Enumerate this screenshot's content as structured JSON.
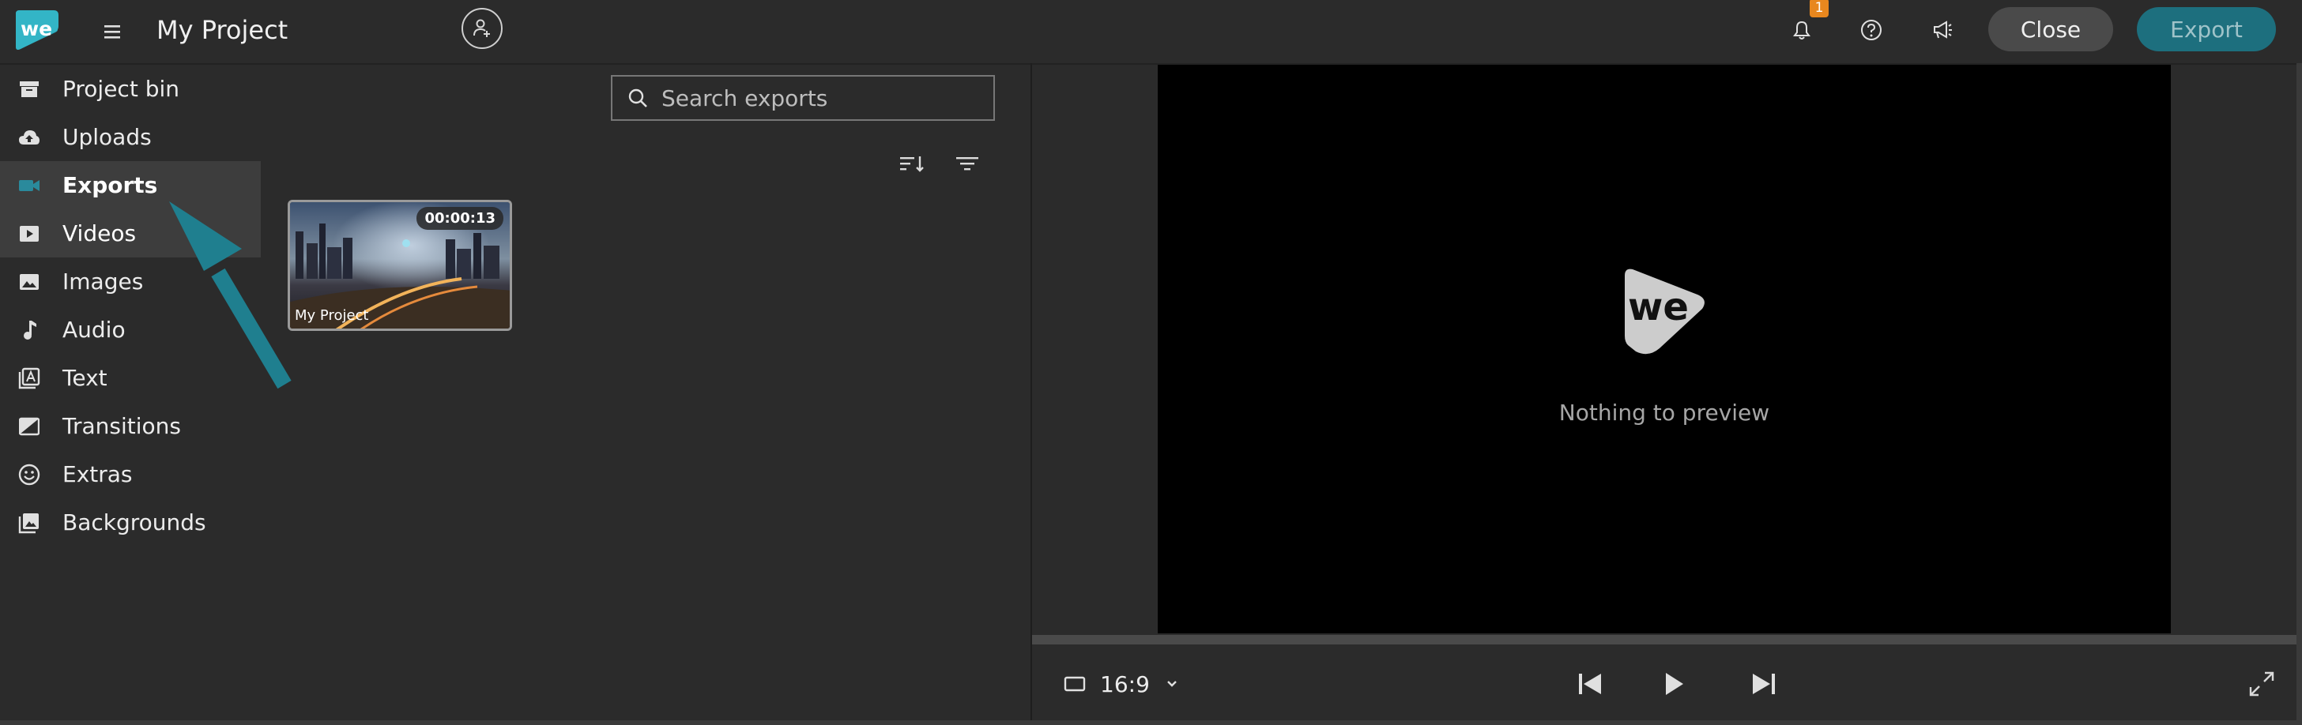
{
  "app": {
    "project_title": "My Project",
    "notification_count": "1",
    "close_label": "Close",
    "export_label": "Export",
    "brand_color": "#1d6f7e",
    "accent_color": "#2a8a9c"
  },
  "sidebar": {
    "items": [
      {
        "label": "Project bin",
        "icon": "archive-icon"
      },
      {
        "label": "Uploads",
        "icon": "cloud-upload-icon"
      },
      {
        "label": "Exports",
        "icon": "video-camera-icon",
        "active": true
      },
      {
        "label": "Videos",
        "icon": "play-box-icon"
      },
      {
        "label": "Images",
        "icon": "image-icon"
      },
      {
        "label": "Audio",
        "icon": "music-note-icon"
      },
      {
        "label": "Text",
        "icon": "text-icon"
      },
      {
        "label": "Transitions",
        "icon": "transition-icon"
      },
      {
        "label": "Extras",
        "icon": "smiley-icon"
      },
      {
        "label": "Backgrounds",
        "icon": "backgrounds-icon"
      }
    ]
  },
  "bin": {
    "search_placeholder": "Search exports",
    "items": [
      {
        "name": "My Project",
        "duration": "00:00:13"
      }
    ]
  },
  "preview": {
    "empty_text": "Nothing to preview",
    "aspect_ratio": "16:9"
  }
}
